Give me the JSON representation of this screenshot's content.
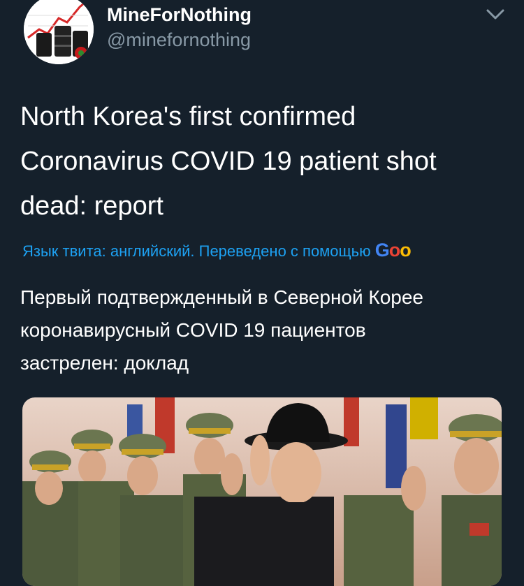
{
  "author": {
    "display_name": "MineForNothing",
    "handle": "@minefornothing",
    "avatar_icon": "oil-barrels-chart-icon"
  },
  "menu_icon": "chevron-down-icon",
  "tweet": {
    "lines": [
      "North Korea's first confirmed",
      "Coronavirus COVID 19 patient shot",
      "dead: report"
    ]
  },
  "translation": {
    "note": "Язык твита: английский. Переведено с помощью",
    "provider_partial": "Goo",
    "lines": [
      "Первый подтвержденный в Северной Корее",
      "коронавирусный COVID 19 пациентов",
      "застрелен: доклад"
    ]
  },
  "media": {
    "description_icon": "military-parade-photo"
  },
  "colors": {
    "background": "#15202b",
    "text": "#ffffff",
    "secondary": "#8899a6",
    "link": "#1da1f2"
  }
}
